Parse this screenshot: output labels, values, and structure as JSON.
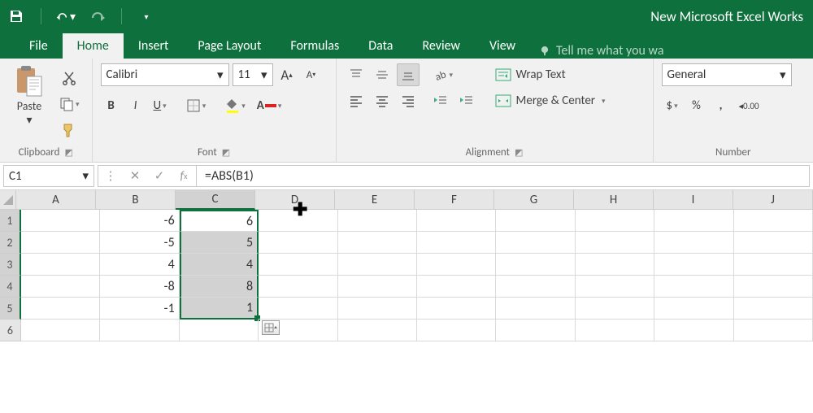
{
  "titlebar": {
    "doc_title": "New Microsoft Excel Works"
  },
  "tabs": {
    "file": "File",
    "home": "Home",
    "insert": "Insert",
    "pagelayout": "Page Layout",
    "formulas": "Formulas",
    "data": "Data",
    "review": "Review",
    "view": "View",
    "tellme": "Tell me what you wa"
  },
  "ribbon": {
    "clipboard": {
      "paste": "Paste",
      "label": "Clipboard"
    },
    "font": {
      "name": "Calibri",
      "size": "11",
      "bold": "B",
      "italic": "I",
      "underline": "U",
      "increase": "A",
      "decrease": "A",
      "label": "Font"
    },
    "alignment": {
      "wrap": "Wrap Text",
      "merge": "Merge & Center",
      "label": "Alignment"
    },
    "number": {
      "format": "General",
      "currency": "$",
      "percent": "%",
      "comma": ",",
      "inc": ".0",
      "dec": ".00",
      "label": "Number"
    }
  },
  "namebox": {
    "ref": "C1"
  },
  "formula": {
    "text": "=ABS(B1)"
  },
  "grid": {
    "colwidths": {
      "A": 98,
      "B": 98,
      "C": 98,
      "D": 98,
      "E": 98,
      "F": 98,
      "G": 98,
      "H": 98,
      "I": 98,
      "J": 98
    },
    "columns": [
      "A",
      "B",
      "C",
      "D",
      "E",
      "F",
      "G",
      "H",
      "I",
      "J"
    ],
    "rows": [
      1,
      2,
      3,
      4,
      5,
      6
    ],
    "data": {
      "B1": "-6",
      "C1": "6",
      "B2": "-5",
      "C2": "5",
      "B3": "4",
      "C3": "4",
      "B4": "-8",
      "C4": "8",
      "B5": "-1",
      "C5": "1"
    },
    "selection": {
      "col": "C",
      "startRow": 1,
      "endRow": 5,
      "activeRow": 1
    }
  }
}
